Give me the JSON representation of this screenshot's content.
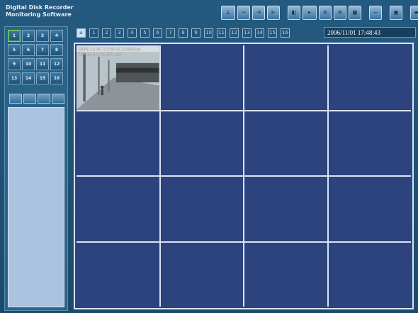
{
  "app": {
    "title_line1": "Digital Disk Recorder",
    "title_line2": "Monitoring Software"
  },
  "toolbar": {
    "buttons": [
      {
        "icon": "playback-slider-icon"
      },
      {
        "icon": "minus-icon"
      },
      {
        "icon": "step-back-icon"
      },
      {
        "icon": "step-forward-icon"
      },
      {
        "icon": "camera-control-icon"
      },
      {
        "icon": "record-play-icon"
      },
      {
        "icon": "link-icon"
      },
      {
        "icon": "list-icon"
      },
      {
        "icon": "separator-icon"
      },
      {
        "icon": "window-icon"
      },
      {
        "icon": "monitor-icon"
      },
      {
        "icon": "exit-icon"
      }
    ]
  },
  "camera_select": {
    "labels": [
      "1",
      "2",
      "3",
      "4",
      "5",
      "6",
      "7",
      "8",
      "9",
      "10",
      "11",
      "12",
      "13",
      "14",
      "15",
      "16"
    ],
    "active": "1"
  },
  "camera_tabs": {
    "labels": [
      "1",
      "2",
      "3",
      "4",
      "5",
      "6",
      "7",
      "8",
      "9",
      "10",
      "11",
      "12",
      "13",
      "14",
      "15",
      "16"
    ]
  },
  "datetime": "2006/11/01  17:48:43",
  "live_cell": {
    "line1": "2006-11-01 17:48:43 1200/3ips",
    "line2": "Recorder1 Cam01 LCF"
  }
}
